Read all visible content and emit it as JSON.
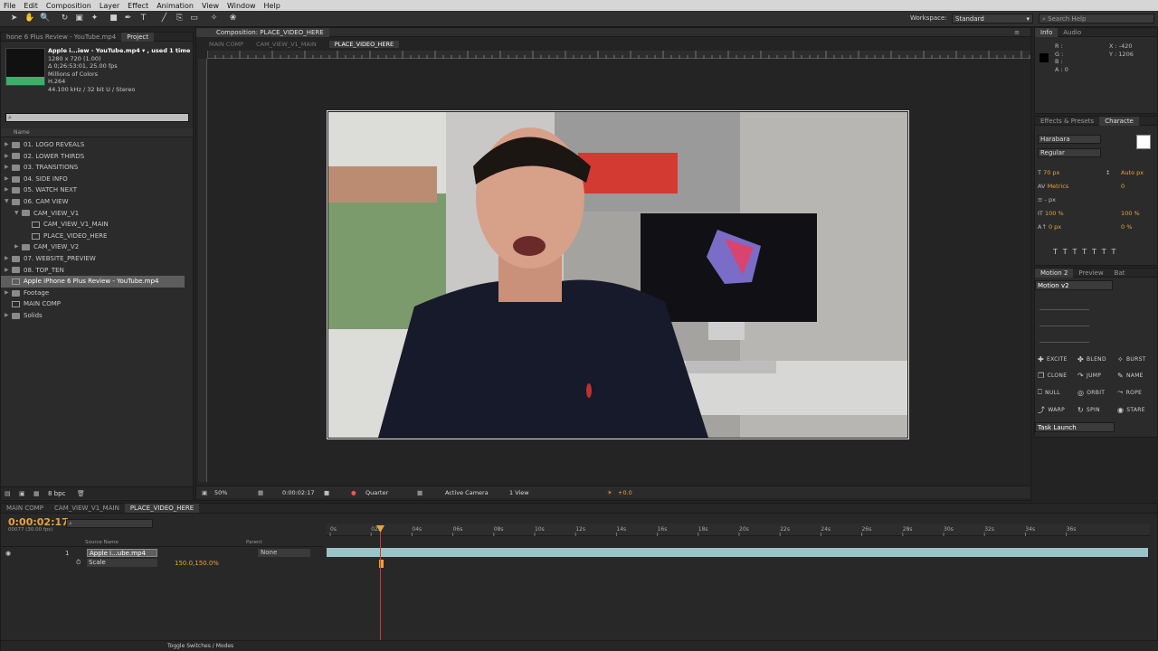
{
  "menu": [
    "File",
    "Edit",
    "Composition",
    "Layer",
    "Effect",
    "Animation",
    "View",
    "Window",
    "Help"
  ],
  "workspace": {
    "label": "Workspace:",
    "value": "Standard"
  },
  "search_help": {
    "placeholder": "Search Help"
  },
  "project": {
    "tab_file": "hone 6 Plus Review - YouTube.mp4",
    "tab_project": "Project",
    "footage_info": {
      "name": "Apple i...iew - YouTube.mp4 ▾ , used 1 time",
      "line2": "1280 x 720 (1.00)",
      "line3": "Δ 0;26:53:01, 25.00 fps",
      "line4": "Millions of Colors",
      "line5": "H.264",
      "line6": "44.100 kHz / 32 bit U / Stereo"
    },
    "column_name": "Name",
    "items": [
      {
        "label": "01. LOGO REVEALS",
        "type": "folder",
        "indent": 0,
        "open": false
      },
      {
        "label": "02. LOWER THIRDS",
        "type": "folder",
        "indent": 0,
        "open": false
      },
      {
        "label": "03. TRANSITIONS",
        "type": "folder",
        "indent": 0,
        "open": false
      },
      {
        "label": "04. SIDE INFO",
        "type": "folder",
        "indent": 0,
        "open": false
      },
      {
        "label": "05. WATCH NEXT",
        "type": "folder",
        "indent": 0,
        "open": false
      },
      {
        "label": "06. CAM VIEW",
        "type": "folder",
        "indent": 0,
        "open": true
      },
      {
        "label": "CAM_VIEW_V1",
        "type": "folder",
        "indent": 1,
        "open": true
      },
      {
        "label": "CAM_VIEW_V1_MAIN",
        "type": "comp",
        "indent": 2,
        "open": false
      },
      {
        "label": "PLACE_VIDEO_HERE",
        "type": "comp",
        "indent": 2,
        "open": false
      },
      {
        "label": "CAM_VIEW_V2",
        "type": "folder",
        "indent": 1,
        "open": false
      },
      {
        "label": "07. WEBSITE_PREVIEW",
        "type": "folder",
        "indent": 0,
        "open": false
      },
      {
        "label": "08. TOP_TEN",
        "type": "folder",
        "indent": 0,
        "open": false
      },
      {
        "label": "Apple iPhone 6 Plus Review - YouTube.mp4",
        "type": "footage",
        "indent": 0,
        "open": false,
        "selected": true
      },
      {
        "label": "Footage",
        "type": "folder",
        "indent": 0,
        "open": false
      },
      {
        "label": "MAIN COMP",
        "type": "comp",
        "indent": 0,
        "open": false
      },
      {
        "label": "Solids",
        "type": "folder",
        "indent": 0,
        "open": false
      }
    ],
    "bpc": "8 bpc"
  },
  "composition": {
    "panel_title": "Composition: PLACE_VIDEO_HERE",
    "breadcrumbs": [
      "MAIN COMP",
      "CAM_VIEW_V1_MAIN",
      "PLACE_VIDEO_HERE"
    ],
    "zoom": "50%",
    "timecode": "0:00:02:17",
    "resolution": "Quarter",
    "camera": "Active Camera",
    "views": "1 View",
    "exposure": "+0.0"
  },
  "info": {
    "tab1": "Info",
    "tab2": "Audio",
    "r": "R :",
    "g": "G :",
    "b": "B :",
    "a": "A : 0",
    "x": "X : -420",
    "y": "Y : 1206"
  },
  "character": {
    "tab_effects": "Effects & Presets",
    "tab_char": "Characte",
    "font": "Harabara",
    "style": "Regular",
    "size": "70 px",
    "leading": "Auto px",
    "kerning": "Metrics",
    "tracking": "0",
    "stroke": "- px",
    "vscale": "100 %",
    "hscale": "100 %",
    "baseline": "0 px",
    "tsume": "0 %"
  },
  "motion": {
    "tab1": "Motion 2",
    "tab2": "Preview",
    "tab3": "Bat",
    "preset": "Motion v2",
    "buttons": [
      "EXCITE",
      "BLEND",
      "BURST",
      "CLONE",
      "JUMP",
      "NAME",
      "NULL",
      "ORBIT",
      "ROPE",
      "WARP",
      "SPIN",
      "STARE"
    ],
    "task": "Task Launch"
  },
  "timeline": {
    "tabs": [
      "MAIN COMP",
      "CAM_VIEW_V1_MAIN",
      "PLACE_VIDEO_HERE"
    ],
    "timecode": "0:00:02:17",
    "frame_info": "00077 (30.00 fps)",
    "col_source": "Source Name",
    "col_parent": "Parent",
    "layer_num": "1",
    "layer_name": "Apple i...ube.mp4",
    "parent_value": "None",
    "prop_name": "Scale",
    "prop_value": "150.0,150.0%",
    "ruler_labels": [
      "0s",
      "02s",
      "04s",
      "06s",
      "08s",
      "10s",
      "12s",
      "14s",
      "16s",
      "18s",
      "20s",
      "22s",
      "24s",
      "26s",
      "28s",
      "30s",
      "32s",
      "34s",
      "36s"
    ],
    "toggle": "Toggle Switches / Modes"
  },
  "colors": {
    "accent": "#e8a33c",
    "playhead": "#d13b2e",
    "layer_bar": "#9bc4c9"
  }
}
